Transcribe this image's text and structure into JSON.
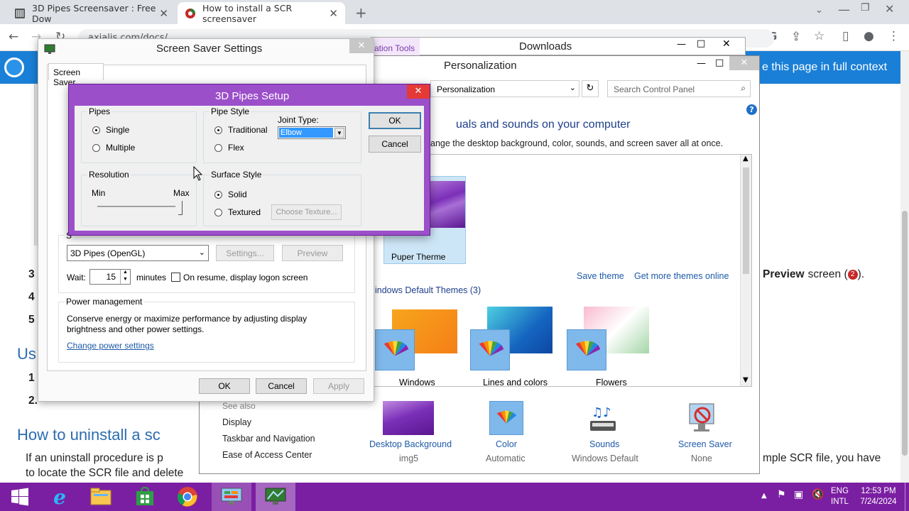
{
  "browser": {
    "tabs": [
      {
        "label": "3D Pipes Screensaver : Free Dow"
      },
      {
        "label": "How to install a SCR screensaver"
      }
    ],
    "url": "axialis.com/docs/..."
  },
  "webpage": {
    "banner_text": "e this page in full context",
    "list_items": [
      "3",
      "4",
      "5",
      "1",
      "2."
    ],
    "preview_text": "Preview",
    "preview_suffix": "screen (",
    "preview_end": ").",
    "heading_use": "Us",
    "heading_uninstall": "How to uninstall a sc",
    "para1": "If an uninstall procedure is p",
    "para2": "to locate the SCR file and delete",
    "para_right": "mple SCR file, you have"
  },
  "personalization": {
    "title": "Personalization",
    "downloads_title": "Downloads",
    "ribbon_label": "ation Tools",
    "breadcrumb": "Personalization",
    "search_placeholder": "Search Control Panel",
    "heading": "uals and sounds on your computer",
    "subheading": "ange the desktop background, color, sounds, and screen saver all at once.",
    "current_theme": "Puper Therme",
    "save_theme": "Save theme",
    "get_more": "Get more themes online",
    "default_header": "indows Default Themes (3)",
    "themes": [
      "Windows",
      "Lines and colors",
      "Flowers"
    ],
    "see_also": "See also",
    "see_also_links": [
      "Display",
      "Taskbar and Navigation",
      "Ease of Access Center"
    ],
    "bottom_items": [
      {
        "label": "Desktop Background",
        "sub": "img5"
      },
      {
        "label": "Color",
        "sub": "Automatic"
      },
      {
        "label": "Sounds",
        "sub": "Windows Default"
      },
      {
        "label": "Screen Saver",
        "sub": "None"
      }
    ]
  },
  "screensaver_settings": {
    "title": "Screen Saver Settings",
    "tab": "Screen Saver",
    "group_label": "S",
    "selected_saver": "3D Pipes (OpenGL)",
    "settings_btn": "Settings...",
    "preview_btn": "Preview",
    "wait_label": "Wait:",
    "wait_value": "15",
    "minutes_label": "minutes",
    "resume_label": "On resume, display logon screen",
    "power_title": "Power management",
    "power_text": "Conserve energy or maximize performance by adjusting display brightness and other power settings.",
    "power_link": "Change power settings",
    "ok": "OK",
    "cancel": "Cancel",
    "apply": "Apply"
  },
  "pipes_setup": {
    "title": "3D Pipes Setup",
    "pipes_group": "Pipes",
    "pipes_options": [
      "Single",
      "Multiple"
    ],
    "pipe_style_group": "Pipe Style",
    "pipe_style_options": [
      "Traditional",
      "Flex"
    ],
    "joint_type_label": "Joint Type:",
    "joint_type_value": "Elbow",
    "resolution_group": "Resolution",
    "res_min": "Min",
    "res_max": "Max",
    "surface_group": "Surface Style",
    "surface_options": [
      "Solid",
      "Textured"
    ],
    "choose_texture": "Choose Texture...",
    "ok": "OK",
    "cancel": "Cancel"
  },
  "taskbar": {
    "lang_top": "ENG",
    "lang_bottom": "INTL",
    "time": "12:53 PM",
    "date": "7/24/2024"
  },
  "colors": {
    "taskbar": "#7b1fa2",
    "dialog_frame": "#9b4fc9",
    "banner": "#1a7fd6",
    "link": "#1e5aa8"
  }
}
